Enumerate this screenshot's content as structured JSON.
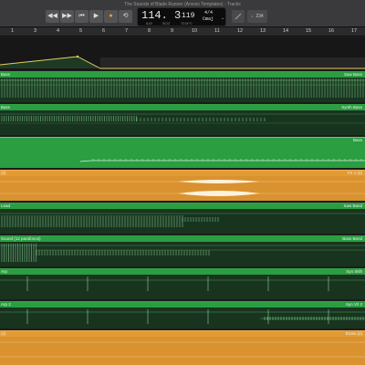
{
  "window": {
    "title": "The Sounds of Blade Runner (Anevis Templates) - Tracks"
  },
  "transport": {
    "rewind_label": "◀◀",
    "forward_label": "▶▶",
    "to_start_label": "⏮",
    "play_label": "▶",
    "record_label": "●",
    "cycle_label": "⟲",
    "position": "114. 3",
    "position_sub_left": "BAR",
    "position_sub_right": "BEAT",
    "tempo": "119",
    "tempo_sub": "TEMPO",
    "time_signature": "4/4",
    "key": "Cmaj",
    "count_in": "♩234"
  },
  "ruler": {
    "marks": [
      "1",
      "3",
      "4",
      "5",
      "6",
      "7",
      "8",
      "9",
      "10",
      "11",
      "12",
      "13",
      "14",
      "15",
      "16",
      "17"
    ]
  },
  "regions": [
    {
      "left_label": "Bass",
      "right_label": "Saw Bass",
      "color": "green"
    },
    {
      "left_label": "Bass",
      "right_label": "Synth Bass",
      "color": "green"
    },
    {
      "left_label": "",
      "right_label": "Bass",
      "color": "green-bright"
    },
    {
      "left_label": "(2)",
      "right_label": "FX 1 (2)",
      "color": "orange"
    },
    {
      "left_label": "Lead",
      "right_label": "Saw Band",
      "color": "green"
    },
    {
      "left_label": "Sound (12 parafonos)",
      "right_label": "Bass Bend",
      "color": "green"
    },
    {
      "left_label": "Arp",
      "right_label": "Syn Sklh",
      "color": "green"
    },
    {
      "left_label": "Arp 2",
      "right_label": "Syn Vrl 2",
      "color": "green"
    },
    {
      "left_label": "(2)",
      "right_label": "Brass (2)",
      "color": "orange"
    }
  ],
  "colors": {
    "region_green": "#2a9e41",
    "region_dark": "#18341f",
    "region_orange": "#d9922f",
    "automation_line": "#e0d060"
  }
}
